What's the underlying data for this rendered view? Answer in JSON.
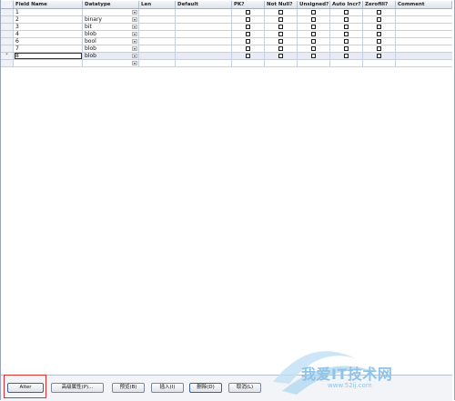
{
  "grid": {
    "columns": [
      "Field Name",
      "Datatype",
      "Len",
      "Default",
      "PK?",
      "Not Null?",
      "Unsigned?",
      "Auto Incr?",
      "Zerofill?",
      "Comment"
    ],
    "rows": [
      {
        "indicator": "",
        "name": "1",
        "type": ""
      },
      {
        "indicator": "",
        "name": "2",
        "type": "binary"
      },
      {
        "indicator": "",
        "name": "3",
        "type": "bit"
      },
      {
        "indicator": "",
        "name": "4",
        "type": "blob"
      },
      {
        "indicator": "",
        "name": "6",
        "type": "bool"
      },
      {
        "indicator": "",
        "name": "7",
        "type": "blob"
      },
      {
        "indicator": "*",
        "name": "8",
        "type": "blob"
      },
      {
        "indicator": "",
        "name": "",
        "type": ""
      }
    ],
    "current_row": 6
  },
  "buttons": {
    "alter": "Alter",
    "advanced": "高级属性(P)...",
    "preview": "预览(B)",
    "insert": "插入(I)",
    "delete": "删除(D)",
    "cancel": "取消(L)"
  },
  "watermark": {
    "text": "我爱IT技术网",
    "url": "www.52ij.com"
  },
  "colors": {
    "highlight": "#d6332c",
    "watermark": "#8fc3e8"
  },
  "icons": {
    "dropdown": "chevron-down-icon",
    "checkbox": "checkbox-icon"
  }
}
